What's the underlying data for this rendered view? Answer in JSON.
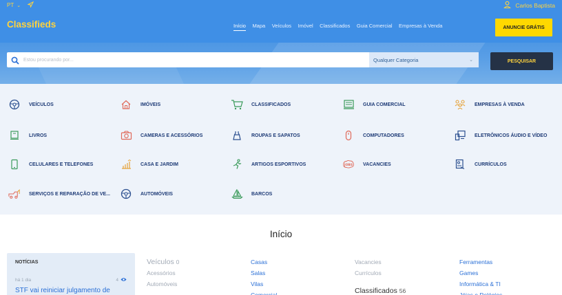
{
  "topbar": {
    "language": "PT",
    "user_name": "Carlos Baptista"
  },
  "header": {
    "brand": "Classifieds",
    "nav": [
      "Início",
      "Mapa",
      "Veículos",
      "Imóvel",
      "Classificados",
      "Guia Comercial",
      "Empresas à Venda"
    ],
    "active_nav": "Início",
    "cta_label": "ANUNCIE GRÁTIS"
  },
  "search": {
    "placeholder": "Estou procurando por...",
    "category_value": "Qualquer Categoria",
    "button_label": "PESQUISAR"
  },
  "categories": [
    {
      "label": "VEÍCULOS",
      "icon": "steering-wheel-icon"
    },
    {
      "label": "IMÓVEIS",
      "icon": "house-icon"
    },
    {
      "label": "CLASSIFICADOS",
      "icon": "cart-icon"
    },
    {
      "label": "GUIA COMERCIAL",
      "icon": "register-icon"
    },
    {
      "label": "EMPRESAS À VENDA",
      "icon": "people-icon"
    },
    {
      "label": "LIVROS",
      "icon": "book-icon"
    },
    {
      "label": "CAMERAS E ACESSÓRIOS",
      "icon": "camera-icon"
    },
    {
      "label": "ROUPAS E SAPATOS",
      "icon": "dress-icon"
    },
    {
      "label": "COMPUTADORES",
      "icon": "mouse-icon"
    },
    {
      "label": "ELETRÔNICOS ÁUDIO E VÍDEO",
      "icon": "devices-icon"
    },
    {
      "label": "CELULARES E TELEFONES",
      "icon": "phone-icon"
    },
    {
      "label": "CASA E JARDIM",
      "icon": "garden-icon"
    },
    {
      "label": "ARTIGOS ESPORTIVOS",
      "icon": "runner-icon"
    },
    {
      "label": "VACANCIES",
      "icon": "jobs-icon"
    },
    {
      "label": "CURRÍCULOS",
      "icon": "resume-icon"
    },
    {
      "label": "SERVIÇOS E REPARAÇÃO DE VE...",
      "icon": "tow-truck-icon"
    },
    {
      "label": "AUTOMÓVEIS",
      "icon": "steering-wheel-icon"
    },
    {
      "label": "BARCOS",
      "icon": "boat-icon"
    }
  ],
  "main": {
    "title": "Início",
    "news": {
      "heading": "NOTÍCIAS",
      "time": "há 1 dia",
      "views": "4",
      "headline": "STF vai reiniciar julgamento de"
    },
    "col_veiculos": {
      "title": "Veículos",
      "count": "0",
      "items": [
        "Acessórios",
        "Automóveis"
      ]
    },
    "col_imoveis": {
      "items": [
        "Casas",
        "Salas",
        "Vilas",
        "Comercial"
      ]
    },
    "col_vacancies": {
      "items": [
        "Vacancies",
        "Currículos"
      ],
      "sub_title": "Classificados",
      "sub_count": "56"
    },
    "col_classificados": {
      "items": [
        "Ferramentas",
        "Games",
        "Informática & TI",
        "Jóias e Relógios"
      ]
    }
  },
  "colors": {
    "brand_blue": "#3f8fe6",
    "accent_yellow": "#ffd800",
    "category_text": "#1d3a76",
    "link_blue": "#2a6fd6"
  }
}
